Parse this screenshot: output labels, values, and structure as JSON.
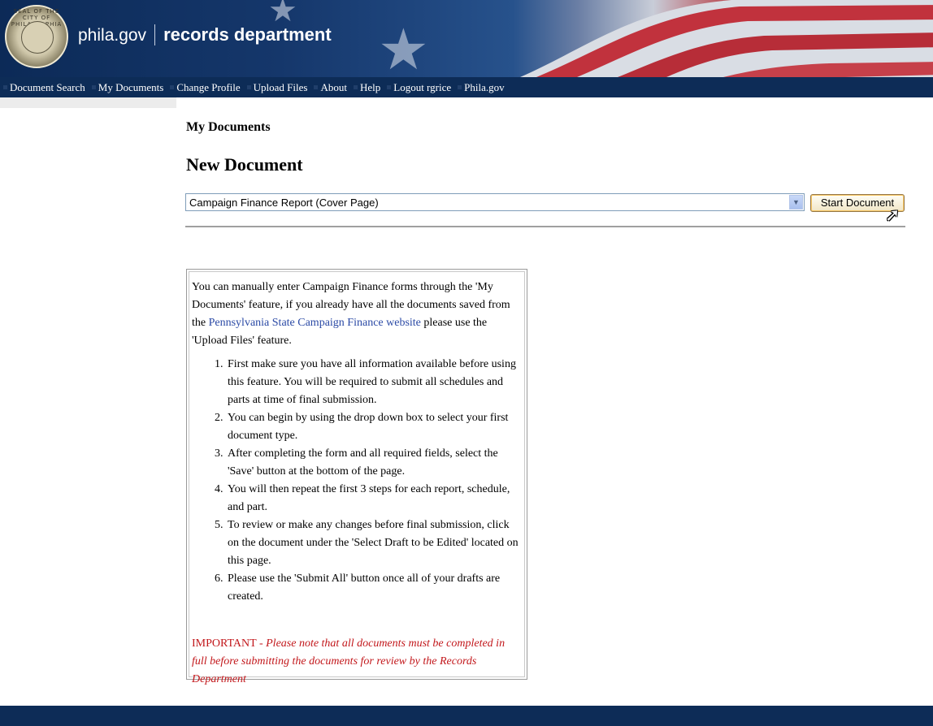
{
  "header": {
    "site": "phila.gov",
    "department": "records department",
    "seal_text": "SEAL OF THE CITY OF PHILADELPHIA"
  },
  "nav": {
    "items": [
      {
        "label": "Document Search"
      },
      {
        "label": "My Documents"
      },
      {
        "label": "Change Profile"
      },
      {
        "label": "Upload Files"
      },
      {
        "label": "About"
      },
      {
        "label": "Help"
      },
      {
        "label": "Logout rgrice"
      },
      {
        "label": "Phila.gov"
      }
    ]
  },
  "main": {
    "section_title": "My Documents",
    "heading": "New Document",
    "doc_type_selected": "Campaign Finance Report (Cover Page)",
    "start_button": "Start Document"
  },
  "info": {
    "intro_before_link": "You can manually enter Campaign Finance forms through the 'My Documents' feature, if you already have all the documents saved from the ",
    "link_text": "Pennsylvania State Campaign Finance website",
    "intro_after_link": " please use the 'Upload Files' feature.",
    "steps": [
      "First make sure you have all information available before using this feature.  You will be required to submit all schedules and parts at time of final submission.",
      "You can begin by using the drop down box to select your first document type.",
      "After completing the form and all required fields, select the 'Save' button at the bottom of the page.",
      "You will then repeat the first 3 steps for each report, schedule, and part.",
      "To review or make any changes before final submission, click on the document under the 'Select Draft to be Edited' located on this page.",
      "Please use the 'Submit All' button once all of your drafts are created."
    ],
    "important_label": "IMPORTANT - ",
    "important_text": "Please note that all documents must be completed in full before submitting the documents for review by the Records Department"
  },
  "colors": {
    "nav_bg": "#0d2c57",
    "link": "#2a49a5",
    "important": "#c2171b"
  }
}
